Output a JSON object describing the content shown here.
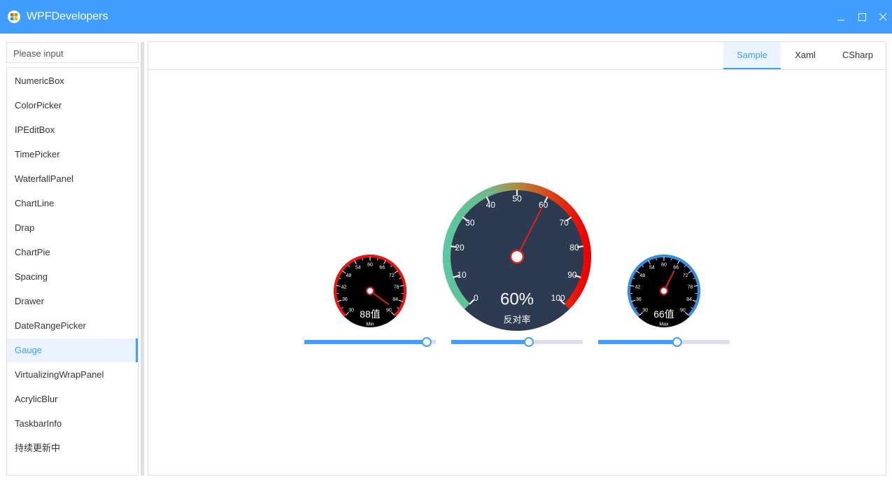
{
  "window": {
    "title": "WPFDevelopers",
    "accent": "#409eff"
  },
  "search": {
    "placeholder": "Please input",
    "value": ""
  },
  "nav": {
    "items": [
      {
        "label": "NumericBox"
      },
      {
        "label": "ColorPicker"
      },
      {
        "label": "IPEditBox"
      },
      {
        "label": "TimePicker"
      },
      {
        "label": "WaterfallPanel"
      },
      {
        "label": "ChartLine"
      },
      {
        "label": "Drap"
      },
      {
        "label": "ChartPie"
      },
      {
        "label": "Spacing"
      },
      {
        "label": "Drawer"
      },
      {
        "label": "DateRangePicker"
      },
      {
        "label": "Gauge"
      },
      {
        "label": "VirtualizingWrapPanel"
      },
      {
        "label": "AcrylicBlur"
      },
      {
        "label": "TaskbarInfo"
      },
      {
        "label": "持续更新中"
      }
    ],
    "selected": "Gauge"
  },
  "tabs": [
    {
      "label": "Sample"
    },
    {
      "label": "Xaml"
    },
    {
      "label": "CSharp"
    }
  ],
  "selected_tab": "Sample",
  "gauges": [
    {
      "name": "left",
      "min": 30,
      "max": 90,
      "value": 88,
      "ticks": [
        "30",
        "36",
        "42",
        "48",
        "54",
        "60",
        "66",
        "72",
        "78",
        "84",
        "90"
      ],
      "value_text": "88值",
      "sub_text": "Min",
      "face": "#000000",
      "ring": "red",
      "needle": "#e02020",
      "slider_fraction": 0.93
    },
    {
      "name": "center",
      "min": 0,
      "max": 100,
      "value": 60,
      "ticks": [
        "0",
        "10",
        "20",
        "30",
        "40",
        "50",
        "60",
        "70",
        "80",
        "90",
        "100"
      ],
      "value_text": "60%",
      "sub_text": "反对率",
      "face": "#2c3a52",
      "ring": "gradient",
      "needle": "#e02020",
      "slider_fraction": 0.59
    },
    {
      "name": "right",
      "min": 30,
      "max": 90,
      "value": 66,
      "ticks": [
        "30",
        "36",
        "42",
        "48",
        "54",
        "60",
        "66",
        "72",
        "78",
        "84",
        "90"
      ],
      "value_text": "66值",
      "sub_text": "Max",
      "face": "#000000",
      "ring": "blue",
      "needle": "#e02020",
      "slider_fraction": 0.6
    }
  ]
}
